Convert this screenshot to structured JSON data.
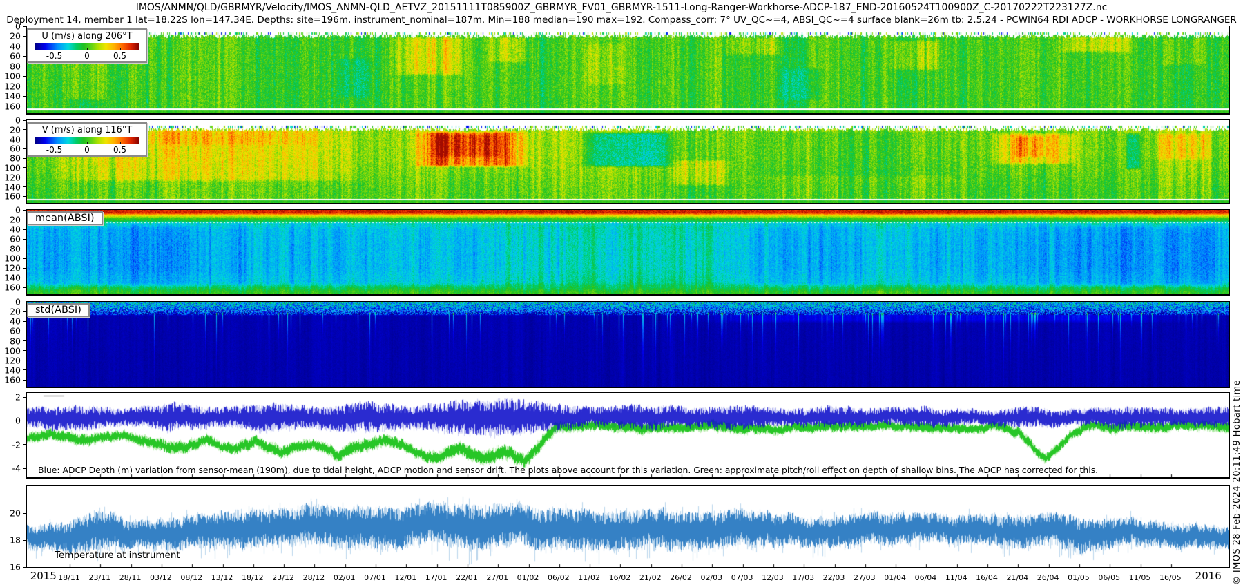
{
  "meta": {
    "title_line1": "IMOS/ANMN/QLD/GBRMYR/Velocity/IMOS_ANMN-QLD_AETVZ_20151111T085900Z_GBRMYR_FV01_GBRMYR-1511-Long-Ranger-Workhorse-ADCP-187_END-20160524T100900Z_C-20170222T223127Z.nc",
    "title_line2": "Deployment 14, member 1 lat=18.22S lon=147.34E. Depths: site=196m, instrument_nominal=187m. Min=188 median=190 max=192. Compass_corr: 7° UV_QC~=4, ABSI_QC~=4 surface blank=26m tb: 2.5.24 - PCWIN64 RDI ADCP - WORKHORSE LONGRANGER",
    "watermark": "© IMOS 28-Feb-2024 20:11:49 Hobart time"
  },
  "colormap_stops": [
    [
      0.0,
      "#00007f"
    ],
    [
      0.1,
      "#0000ee"
    ],
    [
      0.22,
      "#0090ff"
    ],
    [
      0.32,
      "#00d8e0"
    ],
    [
      0.4,
      "#00cc66"
    ],
    [
      0.47,
      "#22c01e"
    ],
    [
      0.53,
      "#52d01a"
    ],
    [
      0.6,
      "#a8e000"
    ],
    [
      0.68,
      "#f0e400"
    ],
    [
      0.76,
      "#ffb000"
    ],
    [
      0.84,
      "#ff6600"
    ],
    [
      0.92,
      "#dd2200"
    ],
    [
      1.0,
      "#7f0000"
    ]
  ],
  "xaxis": {
    "year_start": "2015",
    "year_end": "2016",
    "year_start_day": 2.8,
    "year_end_day": 193.2,
    "first_tick_day": 7,
    "tick_step_days": 5,
    "total_days": 196.5,
    "tick_labels": [
      "18/11",
      "23/11",
      "28/11",
      "03/12",
      "08/12",
      "13/12",
      "18/12",
      "23/12",
      "28/12",
      "02/01",
      "07/01",
      "12/01",
      "17/01",
      "22/01",
      "27/01",
      "01/02",
      "06/02",
      "11/02",
      "16/02",
      "21/02",
      "26/02",
      "02/03",
      "07/03",
      "12/03",
      "17/03",
      "22/03",
      "27/03",
      "01/04",
      "06/04",
      "11/04",
      "16/04",
      "21/04",
      "26/04",
      "01/05",
      "06/05",
      "11/05",
      "16/05"
    ]
  },
  "chart_data": [
    {
      "id": "u_velocity",
      "type": "heatmap",
      "title": "U (m/s) along 206°T",
      "colormap": "jet",
      "colorbar_ticks": [
        "-0.5",
        "0",
        "0.5"
      ],
      "colorbar_range": [
        -0.8,
        0.8
      ],
      "yticks": [
        0,
        20,
        40,
        60,
        80,
        100,
        120,
        140,
        160
      ],
      "depth_max": 174,
      "surface_blank_m": 26,
      "gen": {
        "seed": 11,
        "profile": [
          [
            16,
            0.5
          ],
          [
            80,
            0.5
          ],
          [
            174,
            0.49
          ]
        ],
        "lf_amp": 0.08,
        "stripe_amp": 0.1,
        "noise": 0.075,
        "blank_m": 16,
        "top_speckle": true,
        "bottom_strip": true,
        "episodes": [
          [
            0.03,
            0.07,
            18,
            150,
            0.09
          ],
          [
            0.3,
            0.37,
            18,
            100,
            0.13
          ],
          [
            0.38,
            0.42,
            18,
            75,
            0.09
          ],
          [
            0.575,
            0.635,
            18,
            60,
            0.08
          ],
          [
            0.715,
            0.765,
            25,
            90,
            0.1
          ],
          [
            0.855,
            0.925,
            16,
            55,
            0.12
          ],
          [
            0.94,
            0.985,
            20,
            80,
            0.06
          ],
          [
            0.255,
            0.29,
            60,
            145,
            -0.07
          ],
          [
            0.62,
            0.665,
            80,
            150,
            -0.06
          ],
          [
            0.46,
            0.5,
            30,
            120,
            0.05
          ]
        ]
      }
    },
    {
      "id": "v_velocity",
      "type": "heatmap",
      "title": "V (m/s) along 116°T",
      "colormap": "jet",
      "colorbar_ticks": [
        "-0.5",
        "0",
        "0.5"
      ],
      "colorbar_range": [
        -0.8,
        0.8
      ],
      "yticks": [
        0,
        20,
        40,
        60,
        80,
        100,
        120,
        140,
        160
      ],
      "depth_max": 174,
      "surface_blank_m": 26,
      "gen": {
        "seed": 22,
        "profile": [
          [
            16,
            0.57
          ],
          [
            70,
            0.565
          ],
          [
            110,
            0.545
          ],
          [
            140,
            0.52
          ],
          [
            174,
            0.515
          ]
        ],
        "lf_amp": 0.09,
        "stripe_amp": 0.105,
        "noise": 0.075,
        "blank_m": 16,
        "top_speckle": true,
        "bottom_strip": true,
        "episodes": [
          [
            0.0,
            0.3,
            17,
            130,
            0.09
          ],
          [
            0.0,
            0.27,
            17,
            55,
            0.05
          ],
          [
            0.315,
            0.425,
            20,
            100,
            0.27
          ],
          [
            0.33,
            0.4,
            26,
            80,
            0.09
          ],
          [
            0.455,
            0.545,
            22,
            100,
            -0.21
          ],
          [
            0.53,
            0.59,
            80,
            140,
            0.11
          ],
          [
            0.575,
            0.8,
            20,
            120,
            -0.05
          ],
          [
            0.795,
            0.88,
            24,
            95,
            0.15
          ],
          [
            0.818,
            0.852,
            30,
            80,
            0.09
          ],
          [
            0.912,
            0.928,
            24,
            105,
            -0.17
          ],
          [
            0.932,
            0.99,
            24,
            85,
            0.09
          ]
        ]
      }
    },
    {
      "id": "mean_absi",
      "type": "heatmap",
      "title": "mean(ABSI)",
      "colormap": "jet",
      "yticks": [
        0,
        20,
        40,
        60,
        80,
        100,
        120,
        140,
        160
      ],
      "depth_max": 174,
      "gen": {
        "seed": 33,
        "profile": [
          [
            0,
            0.93
          ],
          [
            6,
            0.92
          ],
          [
            9,
            0.77
          ],
          [
            13,
            0.62
          ],
          [
            17,
            0.5
          ],
          [
            22,
            0.44
          ],
          [
            26,
            0.33
          ],
          [
            40,
            0.28
          ],
          [
            70,
            0.27
          ],
          [
            120,
            0.27
          ],
          [
            150,
            0.3
          ],
          [
            158,
            0.4
          ],
          [
            166,
            0.46
          ],
          [
            174,
            0.5
          ]
        ],
        "lf_amp": 0.05,
        "stripe_amp": 0.075,
        "noise": 0.05,
        "stripe_damp_above_m": 24,
        "dotted_line_m": 26,
        "episodes": [
          [
            0.36,
            0.62,
            28,
            160,
            0.06
          ],
          [
            0.0,
            0.16,
            28,
            160,
            -0.035
          ],
          [
            0.84,
            1.0,
            28,
            160,
            -0.045
          ]
        ]
      }
    },
    {
      "id": "std_absi",
      "type": "heatmap",
      "title": "std(ABSI)",
      "colormap": "jet",
      "yticks": [
        0,
        20,
        40,
        60,
        80,
        100,
        120,
        140,
        160
      ],
      "depth_max": 174,
      "gen": {
        "seed": 44,
        "profile": [
          [
            0,
            0.3
          ],
          [
            3,
            0.28
          ],
          [
            8,
            0.25
          ],
          [
            14,
            0.21
          ],
          [
            20,
            0.14
          ],
          [
            26,
            0.07
          ],
          [
            30,
            0.045
          ],
          [
            174,
            0.04
          ]
        ],
        "lf_amp": 0.0,
        "stripe_amp": 0.018,
        "noise": 0.012,
        "top_noise": 0.17,
        "top_noise_depth": 26,
        "dotted_line_m": 19,
        "drips": {
          "p_left": 0.05,
          "p_right": 0.105,
          "x_split": 0.52,
          "amp": 0.3,
          "len_min": 8,
          "len_max": 46
        },
        "episodes": [
          [
            0.52,
            1.0,
            22,
            44,
            0.05
          ]
        ]
      }
    },
    {
      "id": "depth_variation",
      "type": "line",
      "yticks": [
        2,
        0,
        -2,
        -4
      ],
      "ylim": [
        2.35,
        -4.75
      ],
      "series": [
        {
          "name": "ADCP depth variation from sensor-mean (190m)",
          "color": "#1414cc",
          "light_color": "#9aa0ec"
        },
        {
          "name": "approximate pitch/roll effect on depth of shallow bins",
          "color": "#16c216",
          "light_color": "#90e47e"
        }
      ],
      "annotation": "Blue: ADCP Depth (m) variation from sensor-mean (190m), due to tidal height, ADCP motion and sensor drift. The plots above account for this variation. Green: approximate pitch/roll effect on depth of shallow bins. The ADCP has corrected for this.",
      "gen": {
        "seed": 55,
        "blue_mean": 0.25,
        "blue_amp": [
          [
            0,
            0.9
          ],
          [
            0.04,
            1.15
          ],
          [
            0.08,
            0.75
          ],
          [
            0.12,
            1.25
          ],
          [
            0.16,
            0.85
          ],
          [
            0.2,
            1.3
          ],
          [
            0.24,
            0.95
          ],
          [
            0.28,
            1.4
          ],
          [
            0.32,
            1.0
          ],
          [
            0.36,
            1.55
          ],
          [
            0.4,
            1.7
          ],
          [
            0.44,
            1.2
          ],
          [
            0.47,
            0.85
          ],
          [
            0.51,
            1.15
          ],
          [
            0.55,
            0.9
          ],
          [
            0.59,
            1.1
          ],
          [
            0.63,
            0.8
          ],
          [
            0.67,
            1.0
          ],
          [
            0.71,
            0.75
          ],
          [
            0.75,
            0.95
          ],
          [
            0.79,
            0.65
          ],
          [
            0.83,
            0.95
          ],
          [
            0.87,
            0.7
          ],
          [
            0.91,
            1.05
          ],
          [
            0.95,
            0.8
          ],
          [
            1,
            0.95
          ]
        ],
        "green_base": [
          [
            0,
            -1.5
          ],
          [
            0.02,
            -1.1
          ],
          [
            0.05,
            -1.7
          ],
          [
            0.08,
            -1.25
          ],
          [
            0.1,
            -1.9
          ],
          [
            0.13,
            -2.3
          ],
          [
            0.15,
            -1.55
          ],
          [
            0.17,
            -2.5
          ],
          [
            0.19,
            -1.7
          ],
          [
            0.21,
            -2.7
          ],
          [
            0.24,
            -1.85
          ],
          [
            0.26,
            -2.9
          ],
          [
            0.28,
            -2.0
          ],
          [
            0.3,
            -1.65
          ],
          [
            0.32,
            -2.45
          ],
          [
            0.34,
            -3.1
          ],
          [
            0.36,
            -2.25
          ],
          [
            0.38,
            -3.3
          ],
          [
            0.4,
            -2.6
          ],
          [
            0.415,
            -3.55
          ],
          [
            0.428,
            -1.7
          ],
          [
            0.44,
            -0.55
          ],
          [
            0.47,
            -0.45
          ],
          [
            0.52,
            -0.5
          ],
          [
            0.57,
            -0.42
          ],
          [
            0.61,
            -0.55
          ],
          [
            0.625,
            -0.8
          ],
          [
            0.64,
            -0.45
          ],
          [
            0.7,
            -0.5
          ],
          [
            0.75,
            -0.45
          ],
          [
            0.78,
            -0.6
          ],
          [
            0.805,
            -0.45
          ],
          [
            0.825,
            -0.95
          ],
          [
            0.838,
            -2.3
          ],
          [
            0.848,
            -3.1
          ],
          [
            0.858,
            -2.3
          ],
          [
            0.868,
            -1.0
          ],
          [
            0.885,
            -0.5
          ],
          [
            0.92,
            -0.55
          ],
          [
            0.96,
            -0.45
          ],
          [
            1,
            -0.5
          ]
        ],
        "green_amp_base": 0.3
      }
    },
    {
      "id": "temperature",
      "type": "line",
      "label": "Temperature at instrument",
      "yticks": [
        20,
        18,
        16
      ],
      "ylim": [
        22,
        16
      ],
      "color": "#2e7cc3",
      "light_color": "#8ab9e0",
      "gen": {
        "seed": 66,
        "mean_amp": [
          [
            0,
            18.4,
            0.9
          ],
          [
            0.03,
            18.2,
            1.2
          ],
          [
            0.06,
            18.7,
            1.6
          ],
          [
            0.09,
            18.4,
            1.1
          ],
          [
            0.13,
            18.6,
            1.3
          ],
          [
            0.17,
            18.9,
            1.5
          ],
          [
            0.21,
            19.0,
            1.4
          ],
          [
            0.25,
            19.1,
            1.6
          ],
          [
            0.29,
            18.9,
            1.7
          ],
          [
            0.33,
            19.2,
            1.6
          ],
          [
            0.37,
            19.0,
            1.8
          ],
          [
            0.41,
            19.1,
            1.6
          ],
          [
            0.45,
            18.9,
            1.7
          ],
          [
            0.49,
            18.7,
            1.5
          ],
          [
            0.53,
            18.8,
            1.6
          ],
          [
            0.57,
            18.6,
            1.5
          ],
          [
            0.61,
            18.9,
            1.4
          ],
          [
            0.65,
            18.7,
            1.2
          ],
          [
            0.69,
            18.8,
            1.3
          ],
          [
            0.73,
            18.9,
            1.2
          ],
          [
            0.77,
            18.7,
            1.1
          ],
          [
            0.81,
            18.5,
            1.25
          ],
          [
            0.85,
            18.8,
            1.3
          ],
          [
            0.875,
            18.3,
            1.45
          ],
          [
            0.91,
            18.6,
            1.1
          ],
          [
            0.95,
            18.4,
            1.0
          ],
          [
            1,
            18.2,
            0.85
          ]
        ]
      }
    }
  ]
}
